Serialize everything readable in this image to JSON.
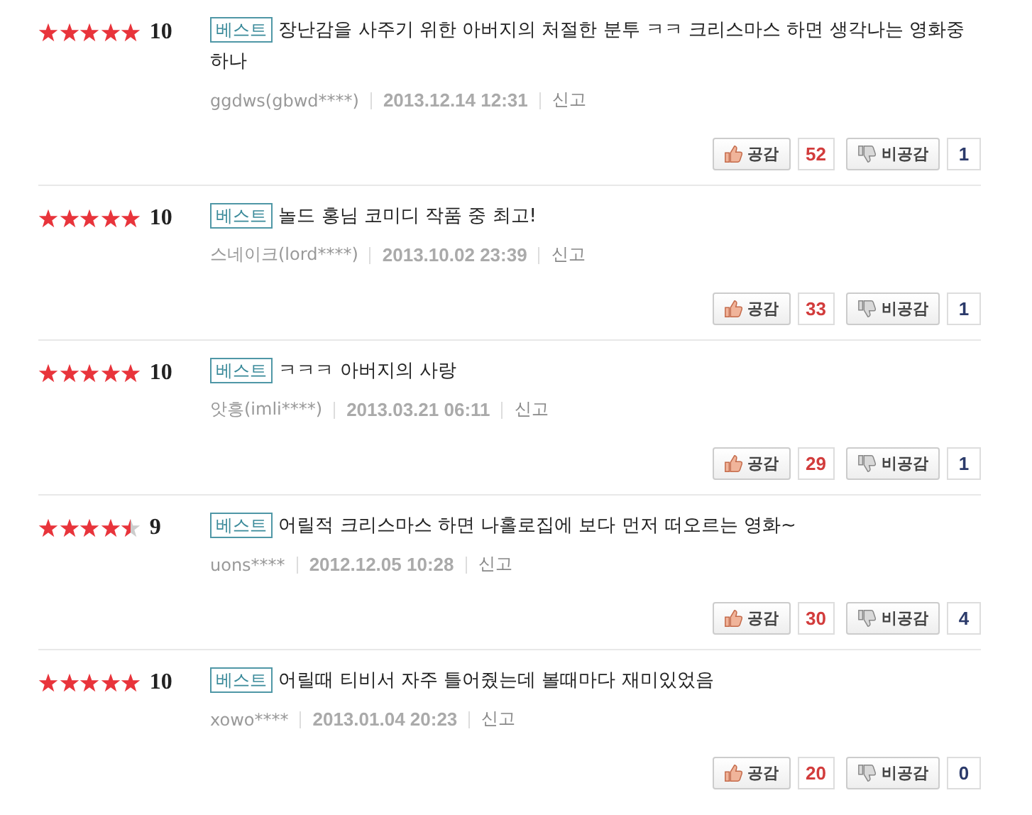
{
  "reviews": [
    {
      "stars": 5,
      "score": "10",
      "badge": "베스트",
      "text": "장난감을 사주기 위한 아버지의 처절한 분투 ㅋㅋ 크리스마스 하면 생각나는 영화중 하나",
      "author": "ggdws(gbwd****)",
      "date": "2013.12.14 12:31",
      "report": "신고",
      "like_label": "공감",
      "likes": "52",
      "dislike_label": "비공감",
      "dislikes": "1"
    },
    {
      "stars": 5,
      "score": "10",
      "badge": "베스트",
      "text": "놀드 홍님 코미디 작품 중 최고!",
      "author": "스네이크(lord****)",
      "date": "2013.10.02 23:39",
      "report": "신고",
      "like_label": "공감",
      "likes": "33",
      "dislike_label": "비공감",
      "dislikes": "1"
    },
    {
      "stars": 5,
      "score": "10",
      "badge": "베스트",
      "text": "ㅋㅋㅋ 아버지의 사랑",
      "author": "앗흥(imli****)",
      "date": "2013.03.21 06:11",
      "report": "신고",
      "like_label": "공감",
      "likes": "29",
      "dislike_label": "비공감",
      "dislikes": "1"
    },
    {
      "stars": 4.5,
      "score": "9",
      "badge": "베스트",
      "text": "어릴적 크리스마스 하면 나홀로집에 보다 먼저 떠오르는 영화~",
      "author": "uons****",
      "date": "2012.12.05 10:28",
      "report": "신고",
      "like_label": "공감",
      "likes": "30",
      "dislike_label": "비공감",
      "dislikes": "4"
    },
    {
      "stars": 5,
      "score": "10",
      "badge": "베스트",
      "text": "어릴때 티비서 자주 틀어줬는데 볼때마다 재미있었음",
      "author": "xowo****",
      "date": "2013.01.04 20:23",
      "report": "신고",
      "like_label": "공감",
      "likes": "20",
      "dislike_label": "비공감",
      "dislikes": "0"
    }
  ]
}
